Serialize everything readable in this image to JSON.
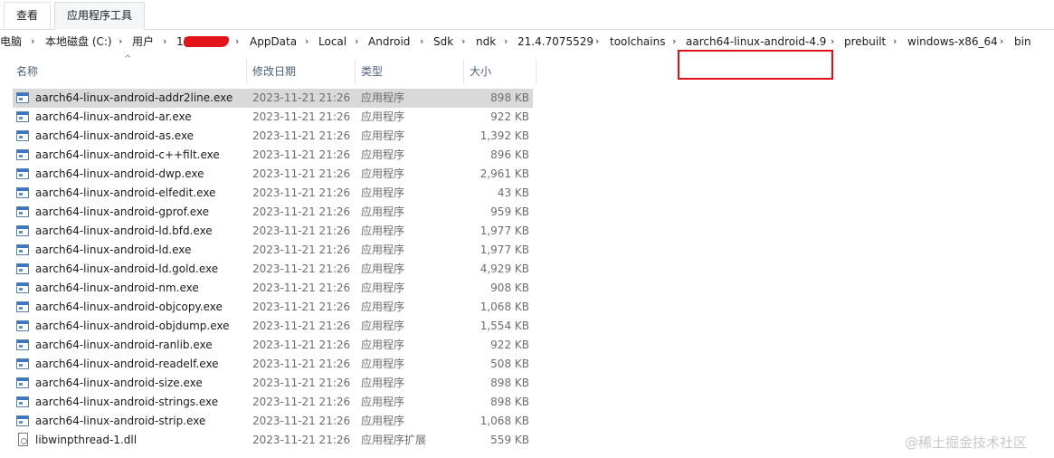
{
  "ribbon": {
    "tabs": [
      "查看",
      "应用程序工具"
    ]
  },
  "address": {
    "crumbs": [
      "电脑",
      "本地磁盘 (C:)",
      "用户",
      "11",
      "AppData",
      "Local",
      "Android",
      "Sdk",
      "ndk",
      "21.4.7075529",
      "toolchains",
      "aarch64-linux-android-4.9",
      "prebuilt",
      "windows-x86_64",
      "bin"
    ],
    "separator": "›"
  },
  "columns": {
    "name": "名称",
    "date": "修改日期",
    "type": "类型",
    "size": "大小"
  },
  "sort_indicator": "^",
  "files": [
    {
      "name": "aarch64-linux-android-addr2line.exe",
      "date": "2023-11-21 21:26",
      "type": "应用程序",
      "size": "898 KB",
      "icon": "exe-icon"
    },
    {
      "name": "aarch64-linux-android-ar.exe",
      "date": "2023-11-21 21:26",
      "type": "应用程序",
      "size": "922 KB",
      "icon": "exe-icon"
    },
    {
      "name": "aarch64-linux-android-as.exe",
      "date": "2023-11-21 21:26",
      "type": "应用程序",
      "size": "1,392 KB",
      "icon": "exe-icon"
    },
    {
      "name": "aarch64-linux-android-c++filt.exe",
      "date": "2023-11-21 21:26",
      "type": "应用程序",
      "size": "896 KB",
      "icon": "exe-icon"
    },
    {
      "name": "aarch64-linux-android-dwp.exe",
      "date": "2023-11-21 21:26",
      "type": "应用程序",
      "size": "2,961 KB",
      "icon": "exe-icon"
    },
    {
      "name": "aarch64-linux-android-elfedit.exe",
      "date": "2023-11-21 21:26",
      "type": "应用程序",
      "size": "43 KB",
      "icon": "exe-icon"
    },
    {
      "name": "aarch64-linux-android-gprof.exe",
      "date": "2023-11-21 21:26",
      "type": "应用程序",
      "size": "959 KB",
      "icon": "exe-icon"
    },
    {
      "name": "aarch64-linux-android-ld.bfd.exe",
      "date": "2023-11-21 21:26",
      "type": "应用程序",
      "size": "1,977 KB",
      "icon": "exe-icon"
    },
    {
      "name": "aarch64-linux-android-ld.exe",
      "date": "2023-11-21 21:26",
      "type": "应用程序",
      "size": "1,977 KB",
      "icon": "exe-icon"
    },
    {
      "name": "aarch64-linux-android-ld.gold.exe",
      "date": "2023-11-21 21:26",
      "type": "应用程序",
      "size": "4,929 KB",
      "icon": "exe-icon"
    },
    {
      "name": "aarch64-linux-android-nm.exe",
      "date": "2023-11-21 21:26",
      "type": "应用程序",
      "size": "908 KB",
      "icon": "exe-icon"
    },
    {
      "name": "aarch64-linux-android-objcopy.exe",
      "date": "2023-11-21 21:26",
      "type": "应用程序",
      "size": "1,068 KB",
      "icon": "exe-icon"
    },
    {
      "name": "aarch64-linux-android-objdump.exe",
      "date": "2023-11-21 21:26",
      "type": "应用程序",
      "size": "1,554 KB",
      "icon": "exe-icon"
    },
    {
      "name": "aarch64-linux-android-ranlib.exe",
      "date": "2023-11-21 21:26",
      "type": "应用程序",
      "size": "922 KB",
      "icon": "exe-icon"
    },
    {
      "name": "aarch64-linux-android-readelf.exe",
      "date": "2023-11-21 21:26",
      "type": "应用程序",
      "size": "508 KB",
      "icon": "exe-icon"
    },
    {
      "name": "aarch64-linux-android-size.exe",
      "date": "2023-11-21 21:26",
      "type": "应用程序",
      "size": "898 KB",
      "icon": "exe-icon"
    },
    {
      "name": "aarch64-linux-android-strings.exe",
      "date": "2023-11-21 21:26",
      "type": "应用程序",
      "size": "898 KB",
      "icon": "exe-icon"
    },
    {
      "name": "aarch64-linux-android-strip.exe",
      "date": "2023-11-21 21:26",
      "type": "应用程序",
      "size": "1,068 KB",
      "icon": "exe-icon"
    },
    {
      "name": "libwinpthread-1.dll",
      "date": "2023-11-21 21:26",
      "type": "应用程序扩展",
      "size": "559 KB",
      "icon": "dll-icon"
    }
  ],
  "selected_index": 0,
  "watermark": "@稀土掘金技术社区",
  "colors": {
    "highlight": "#e3101a",
    "selected_row": "#d9d9d9"
  }
}
